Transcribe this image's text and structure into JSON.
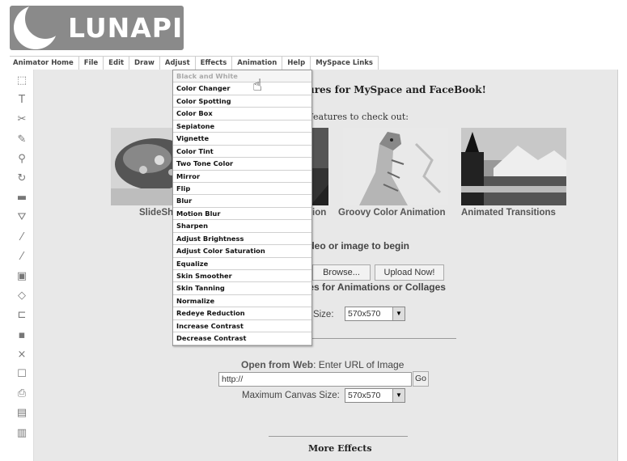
{
  "logo": {
    "text": "LUNAPIC"
  },
  "menu": [
    "Animator Home",
    "File",
    "Edit",
    "Draw",
    "Adjust",
    "Effects",
    "Animation",
    "Help",
    "MySpace Links"
  ],
  "toolbar": {
    "tools": [
      "marquee-select",
      "text-tool",
      "scissors-tool",
      "pencil-tool",
      "zoom-tool",
      "rotate-tool",
      "fill-rect-tool",
      "paint-bucket-tool",
      "eyedropper-tool",
      "brush-tool",
      "frames-tool",
      "eraser-tool",
      "open-tool",
      "save-tool",
      "close-tool",
      "new-page-tool",
      "print-tool",
      "paste-tool",
      "copy-tool"
    ],
    "glyphs": [
      "⬚",
      "T",
      "✂",
      "✎",
      "⚲",
      "↻",
      "▬",
      "⛛",
      "⁄",
      "⁄",
      "▣",
      "◇",
      "⊏",
      "▪",
      "×",
      "☐",
      "⎙",
      "▤",
      "▥"
    ]
  },
  "content": {
    "heading": "ures for MySpace and FaceBook!",
    "features_text": "Features to check out:",
    "captions": [
      "SlideSh",
      "ion",
      "Groovy Color Animation",
      "Animated Transitions"
    ],
    "upload_label": "ideo or image to begin",
    "browse_label": "Browse...",
    "upload_now_label": "Upload Now!",
    "multi_label": "ies for Animations or Collages",
    "canvas_size_label_1": "s Size:",
    "canvas_size_value": "570x570",
    "open_web_bold": "Open from Web",
    "open_web_text": ": Enter URL of Image",
    "url_value": "http://",
    "go_label": "Go",
    "canvas_size_label_2": "Maximum Canvas Size:",
    "more_effects": "More Effects"
  },
  "dropdown": {
    "items": [
      "Black and White",
      "Color Changer",
      "Color Spotting",
      "Color Box",
      "Sepiatone",
      "Vignette",
      "Color Tint",
      "Two Tone Color",
      "Mirror",
      "Flip",
      "Blur",
      "Motion Blur",
      "Sharpen",
      "Adjust Brightness",
      "Adjust Color Saturation",
      "Equalize",
      "Skin Smoother",
      "Skin Tanning",
      "Normalize",
      "Redeye Reduction",
      "Increase Contrast",
      "Decrease Contrast"
    ],
    "disabled_index": 0
  },
  "colors": {
    "content_bg": "#e8e8e8",
    "logo_bg": "#8a8a8a"
  }
}
